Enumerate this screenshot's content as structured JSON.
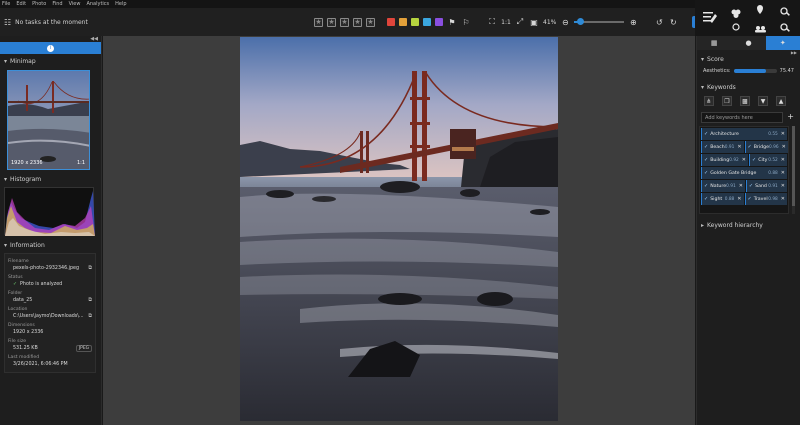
{
  "menu": [
    "File",
    "Edit",
    "Photo",
    "Find",
    "View",
    "Analytics",
    "Help"
  ],
  "toolbar": {
    "tasks_status": "No tasks at the moment",
    "zoom": "41%",
    "fit_label": "1:1",
    "color_labels": [
      "#e0453b",
      "#e3a13a",
      "#b6d43f",
      "#3ba7e0",
      "#8a4fe0"
    ]
  },
  "left_panel": {
    "minimap": {
      "title": "Minimap",
      "dims": "1920 x 2336",
      "ratio": "1:1"
    },
    "histogram": {
      "title": "Histogram"
    },
    "information": {
      "title": "Information",
      "filename_label": "Filename",
      "filename": "pexels-photo-2932346.jpeg",
      "status_label": "Status",
      "status": "Photo is analyzed",
      "folder_label": "Folder",
      "folder": "data_25",
      "location_label": "Location",
      "location": "C:\\Users\\jaymo\\Downloads\\...",
      "dimensions_label": "Dimensions",
      "dimensions": "1920 x 2336",
      "filesize_label": "File size",
      "filesize": "531.25 KB",
      "format": "JPEG",
      "modified_label": "Last modified",
      "modified": "3/26/2021, 6:06:46 PM"
    }
  },
  "right_panel": {
    "score": {
      "title": "Score",
      "label": "Aesthetics:",
      "value": "75.47",
      "fraction": 0.755
    },
    "keywords": {
      "title": "Keywords",
      "placeholder": "Add keywords here",
      "rows": [
        [
          {
            "name": "Architecture",
            "score": "0.55"
          }
        ],
        [
          {
            "name": "Beach",
            "score": "0.91"
          },
          {
            "name": "Bridge",
            "score": "0.96"
          }
        ],
        [
          {
            "name": "Building",
            "score": "0.92"
          },
          {
            "name": "City",
            "score": "0.52"
          }
        ],
        [
          {
            "name": "Golden Gate Bridge",
            "score": "0.88"
          }
        ],
        [
          {
            "name": "Nature",
            "score": "0.91"
          },
          {
            "name": "Sand",
            "score": "0.91"
          }
        ],
        [
          {
            "name": "Sight",
            "score": "0.88"
          },
          {
            "name": "Travel",
            "score": "0.98"
          }
        ]
      ]
    },
    "hierarchy": {
      "title": "Keyword hierarchy"
    }
  }
}
